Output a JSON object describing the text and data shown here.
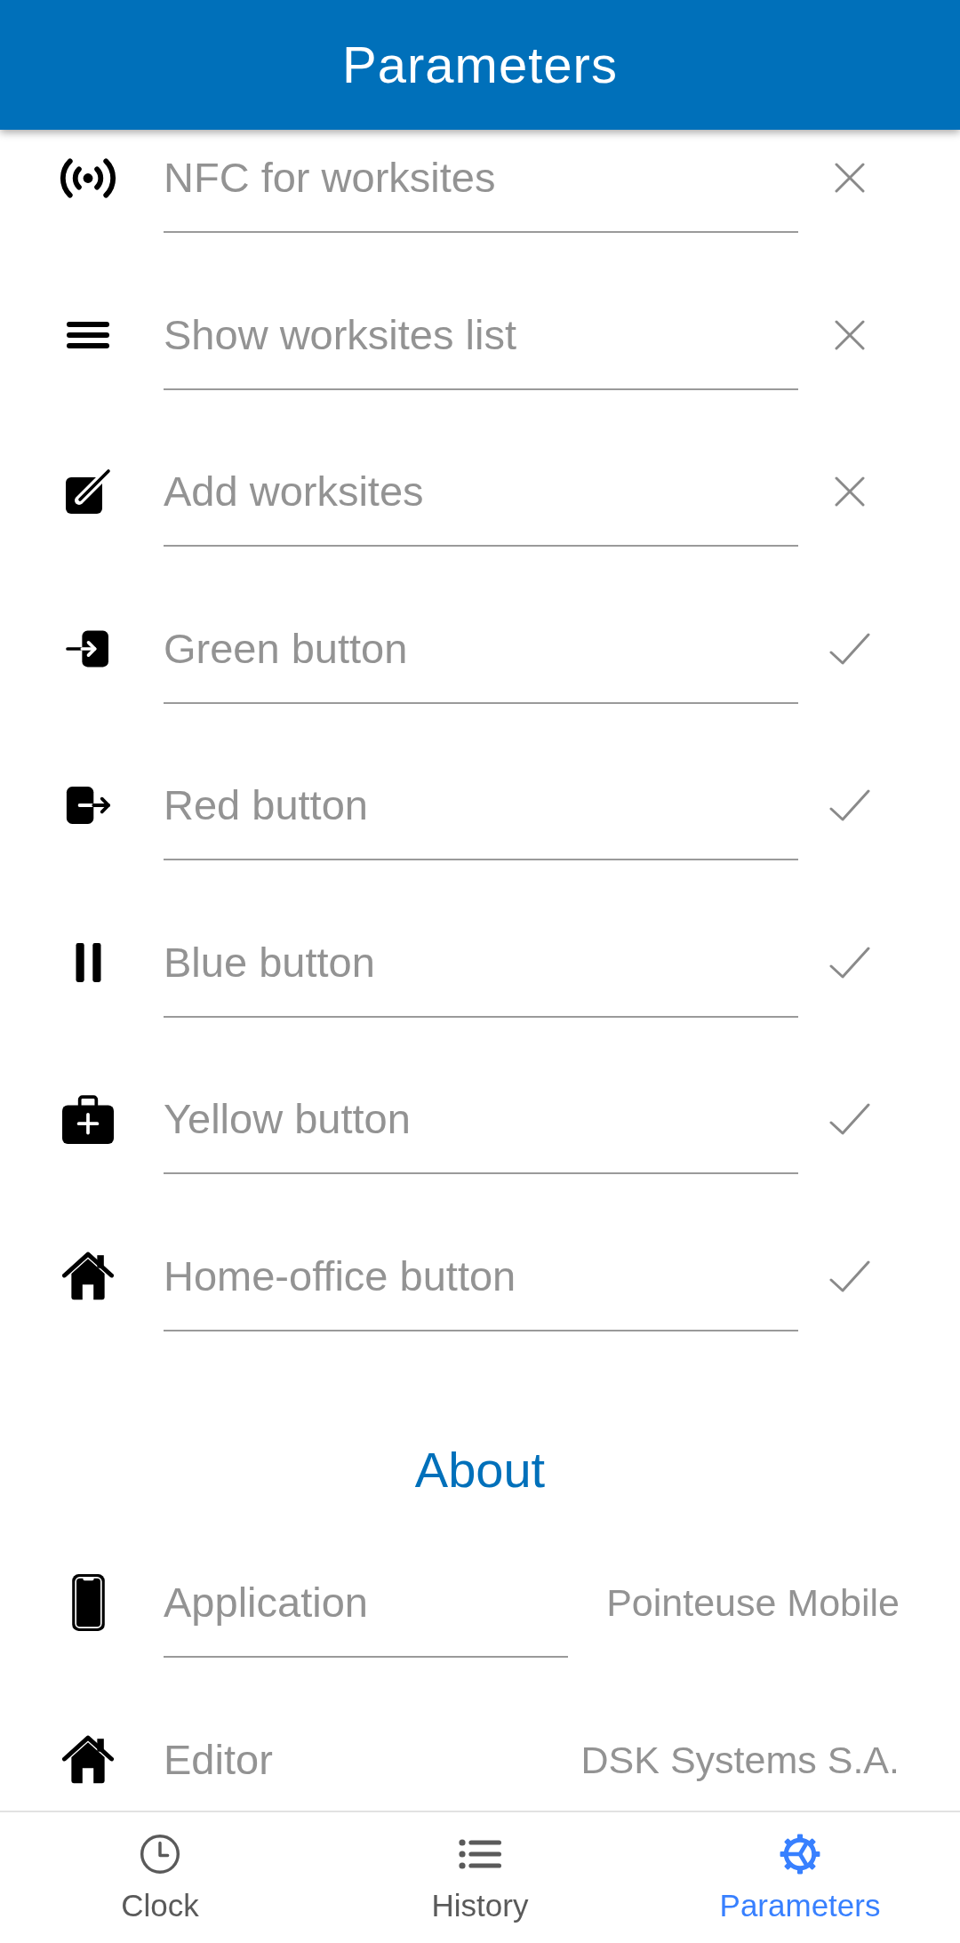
{
  "header": {
    "title": "Parameters"
  },
  "settings": [
    {
      "label": "NFC for worksites",
      "on": false
    },
    {
      "label": "Show worksites list",
      "on": false
    },
    {
      "label": "Add worksites",
      "on": false
    },
    {
      "label": "Green button",
      "on": true
    },
    {
      "label": "Red button",
      "on": true
    },
    {
      "label": "Blue button",
      "on": true
    },
    {
      "label": "Yellow button",
      "on": true
    },
    {
      "label": "Home-office button",
      "on": true
    }
  ],
  "about": {
    "title": "About",
    "rows": [
      {
        "label": "Application",
        "value": "Pointeuse Mobile"
      },
      {
        "label": "Editor",
        "value": "DSK Systems S.A."
      }
    ]
  },
  "tab_bar": {
    "tabs": [
      {
        "label": "Clock",
        "selected": false
      },
      {
        "label": "History",
        "selected": false
      },
      {
        "label": "Parameters",
        "selected": true
      }
    ]
  }
}
